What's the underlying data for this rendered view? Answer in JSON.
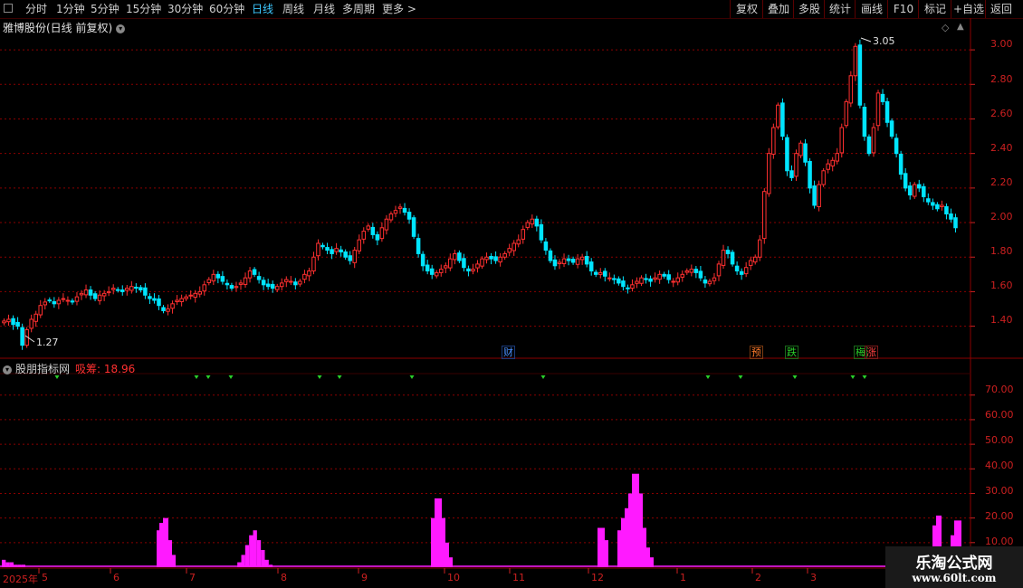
{
  "toolbar": {
    "periods": [
      "分时",
      "1分钟",
      "5分钟",
      "15分钟",
      "30分钟",
      "60分钟",
      "日线",
      "周线",
      "月线",
      "多周期",
      "更多 >"
    ],
    "active_period": "日线",
    "actions": [
      "复权",
      "叠加",
      "多股",
      "统计",
      "画线",
      "F10",
      "标记",
      "+自选",
      "返回"
    ]
  },
  "stock": {
    "title": "雅博股份(日线 前复权)",
    "high_label": "3.05",
    "low_label": "1.27"
  },
  "price_axis": [
    "3.00",
    "2.80",
    "2.60",
    "2.40",
    "2.20",
    "2.00",
    "1.80",
    "1.60",
    "1.40"
  ],
  "events": [
    {
      "text": "财",
      "color": "#4a90ff"
    },
    {
      "text": "预",
      "color": "#ff7a2a"
    },
    {
      "text": "跌",
      "color": "#2ad02a"
    },
    {
      "text": "梅",
      "color": "#2ad02a"
    },
    {
      "text": "涨",
      "color": "#ff4040"
    }
  ],
  "indicator": {
    "title": "股朋指标网",
    "name": "吸筹",
    "value": ": 18.96",
    "axis": [
      "70.00",
      "60.00",
      "50.00",
      "40.00",
      "30.00",
      "20.00",
      "10.00"
    ]
  },
  "x_axis": [
    "2025年",
    "5",
    "6",
    "7",
    "8",
    "9",
    "10",
    "11",
    "12",
    "1",
    "2",
    "3"
  ],
  "watermark": {
    "line1": "乐淘公式网",
    "line2": "www.60lt.com"
  },
  "colors": {
    "up": "#ff3030",
    "down": "#00e5ff",
    "indicator": "#ff1aff",
    "grid": "#8a0000",
    "axis": "#cc2020",
    "active": "#3dc8ff"
  },
  "chart_data": {
    "type": "candlestick+bar",
    "price_range": [
      1.27,
      3.05
    ],
    "price_ylim": [
      1.22,
      3.1
    ],
    "indicator_ylim": [
      0,
      78
    ],
    "close": [
      1.43,
      1.44,
      1.41,
      1.4,
      1.29,
      1.38,
      1.44,
      1.47,
      1.52,
      1.54,
      1.55,
      1.53,
      1.55,
      1.56,
      1.55,
      1.54,
      1.57,
      1.59,
      1.61,
      1.58,
      1.56,
      1.58,
      1.59,
      1.6,
      1.62,
      1.61,
      1.6,
      1.62,
      1.63,
      1.62,
      1.61,
      1.58,
      1.56,
      1.55,
      1.52,
      1.49,
      1.5,
      1.53,
      1.55,
      1.56,
      1.57,
      1.58,
      1.59,
      1.6,
      1.64,
      1.67,
      1.7,
      1.68,
      1.66,
      1.64,
      1.62,
      1.63,
      1.65,
      1.68,
      1.72,
      1.7,
      1.67,
      1.64,
      1.63,
      1.62,
      1.63,
      1.65,
      1.67,
      1.66,
      1.64,
      1.66,
      1.7,
      1.72,
      1.8,
      1.88,
      1.86,
      1.84,
      1.82,
      1.85,
      1.83,
      1.8,
      1.78,
      1.84,
      1.9,
      1.95,
      1.98,
      1.93,
      1.9,
      1.97,
      2.02,
      2.05,
      2.07,
      2.09,
      2.06,
      2.02,
      1.92,
      1.82,
      1.75,
      1.72,
      1.7,
      1.71,
      1.73,
      1.75,
      1.79,
      1.82,
      1.78,
      1.74,
      1.72,
      1.73,
      1.76,
      1.79,
      1.8,
      1.79,
      1.78,
      1.8,
      1.82,
      1.85,
      1.88,
      1.9,
      1.96,
      2.0,
      2.02,
      1.98,
      1.9,
      1.84,
      1.78,
      1.75,
      1.77,
      1.79,
      1.78,
      1.77,
      1.79,
      1.8,
      1.76,
      1.72,
      1.7,
      1.71,
      1.69,
      1.68,
      1.67,
      1.65,
      1.63,
      1.62,
      1.64,
      1.66,
      1.68,
      1.67,
      1.66,
      1.68,
      1.7,
      1.69,
      1.67,
      1.66,
      1.68,
      1.7,
      1.72,
      1.73,
      1.71,
      1.68,
      1.65,
      1.66,
      1.68,
      1.76,
      1.84,
      1.82,
      1.76,
      1.72,
      1.7,
      1.74,
      1.78,
      1.8,
      1.9,
      2.18,
      2.4,
      2.55,
      2.68,
      2.5,
      2.3,
      2.26,
      2.4,
      2.46,
      2.35,
      2.2,
      2.1,
      2.22,
      2.3,
      2.34,
      2.36,
      2.4,
      2.55,
      2.7,
      2.85,
      3.02,
      2.68,
      2.5,
      2.4,
      2.55,
      2.75,
      2.7,
      2.58,
      2.5,
      2.4,
      2.28,
      2.2,
      2.16,
      2.22,
      2.2,
      2.15,
      2.12,
      2.1,
      2.08,
      2.1,
      2.05,
      2.02,
      1.97
    ],
    "indicator": [
      3,
      2,
      2,
      1,
      1,
      1,
      0,
      0,
      0,
      0,
      0,
      0,
      0,
      0,
      0,
      0,
      0,
      0,
      0,
      0,
      0,
      0,
      0,
      0,
      0,
      0,
      0,
      0,
      0,
      0,
      0,
      0,
      0,
      0,
      0,
      0,
      0,
      0,
      0,
      0,
      0,
      0,
      0,
      0,
      0,
      0,
      0,
      0,
      0,
      0,
      0,
      0,
      0,
      0,
      0,
      0,
      0,
      0,
      0,
      0,
      2,
      5,
      9,
      13,
      15,
      11,
      7,
      3,
      1,
      0,
      0,
      0,
      0,
      0,
      0,
      0,
      0,
      0,
      0,
      0,
      0,
      0,
      0,
      0,
      0,
      0,
      0,
      0,
      0,
      0,
      0,
      0,
      0,
      0,
      0,
      0,
      0,
      0,
      0,
      0,
      0,
      0,
      0,
      0,
      0,
      0,
      0,
      0,
      0,
      0,
      0,
      0,
      0,
      0,
      0,
      0,
      0,
      0,
      0,
      0,
      0,
      0,
      0,
      0,
      0,
      0,
      0,
      0,
      0,
      0,
      0,
      0,
      0,
      0,
      0,
      0,
      0,
      0,
      0,
      0,
      0,
      0,
      0,
      0,
      0,
      0,
      0,
      0,
      0,
      0,
      0,
      0,
      0,
      0,
      0,
      0,
      0,
      0,
      0,
      0,
      0,
      0,
      0,
      0,
      0,
      0,
      0,
      0,
      0,
      0,
      0,
      0,
      0,
      0,
      0,
      0,
      0,
      0,
      0,
      0,
      0,
      0,
      0,
      0,
      0,
      0,
      0,
      0,
      0,
      0,
      0,
      0,
      0,
      0,
      0,
      0,
      0,
      0,
      0,
      0,
      0,
      0,
      0,
      0,
      0,
      0,
      0,
      0,
      0,
      0,
      0,
      0,
      0,
      0,
      0,
      0,
      0,
      0,
      0,
      0,
      0,
      0,
      0,
      0,
      0,
      0,
      0,
      0,
      0,
      0,
      0,
      0,
      0,
      0,
      0,
      0,
      0,
      0,
      0,
      0,
      0,
      0,
      0,
      0
    ]
  }
}
